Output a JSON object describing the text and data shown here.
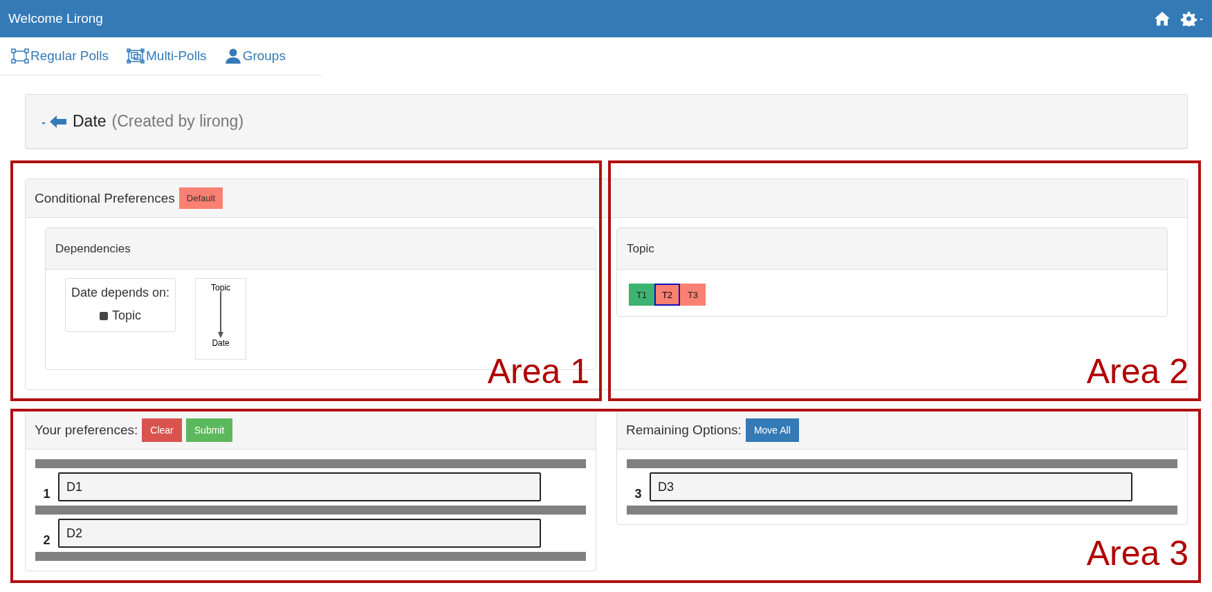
{
  "navbar": {
    "title": "Welcome Lirong"
  },
  "nav": [
    {
      "label": "Regular Polls",
      "kind": "square"
    },
    {
      "label": "Multi-Polls",
      "kind": "squares"
    },
    {
      "label": "Groups",
      "kind": "person"
    }
  ],
  "poll": {
    "title": "Date",
    "creator": "(Created by lirong)"
  },
  "conditional": {
    "title": "Conditional Preferences",
    "badge": "Default",
    "dependencies": {
      "title": "Dependencies",
      "label": "Date depends on:",
      "options": [
        {
          "label": "Topic",
          "checked": true
        }
      ],
      "graph": {
        "from": "Topic",
        "to": "Date"
      }
    },
    "topic": {
      "title": "Topic",
      "values": [
        {
          "label": "T1",
          "color": "#3cb371",
          "selected": false
        },
        {
          "label": "T2",
          "color": "#fa8072",
          "selected": true
        },
        {
          "label": "T3",
          "color": "#fa8072",
          "selected": false
        }
      ]
    }
  },
  "preferences": {
    "title": "Your preferences:",
    "buttons": [
      {
        "label": "Clear",
        "kind": "danger"
      },
      {
        "label": "Submit",
        "kind": "success"
      }
    ],
    "items": [
      {
        "rank": "1",
        "label": "D1"
      },
      {
        "rank": "2",
        "label": "D2"
      }
    ]
  },
  "remaining": {
    "title": "Remaining Options:",
    "buttons": [
      {
        "label": "Move All",
        "kind": "primary"
      }
    ],
    "items": [
      {
        "rank": "3",
        "label": "D3"
      }
    ]
  },
  "annotations": [
    {
      "label": "Area 1"
    },
    {
      "label": "Area 2"
    },
    {
      "label": "Area 3"
    }
  ]
}
